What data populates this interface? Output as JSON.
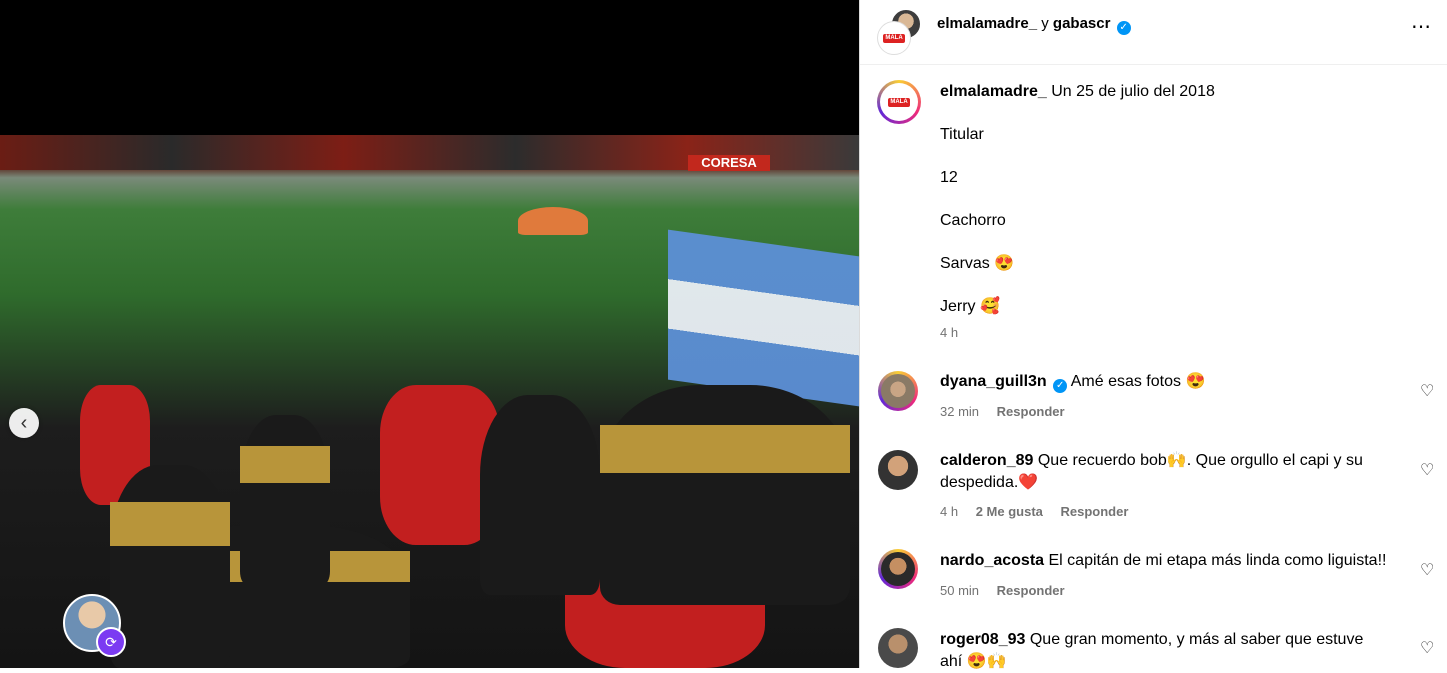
{
  "header": {
    "user1": "elmalamadre_",
    "joiner": "y",
    "user2": "gabascr",
    "more_icon": "more-horizontal-icon"
  },
  "media": {
    "sign_text": "CORESA",
    "prev_icon": "‹",
    "tag_badge_icon": "⟳"
  },
  "caption": {
    "username": "elmalamadre_",
    "first_line": "Un 25 de julio del 2018",
    "lines": [
      "Titular",
      "12",
      "Cachorro",
      "Sarvas 😍",
      "Jerry 🥰"
    ],
    "time": "4 h"
  },
  "comments": [
    {
      "username": "dyana_guill3n",
      "verified": true,
      "text": "Amé esas fotos 😍",
      "time": "32 min",
      "likes": "",
      "reply": "Responder"
    },
    {
      "username": "calderon_89",
      "verified": false,
      "text": "Que recuerdo bob🙌. Que orgullo el capi y su despedida.❤️",
      "time": "4 h",
      "likes": "2 Me gusta",
      "reply": "Responder"
    },
    {
      "username": "nardo_acosta",
      "verified": false,
      "text": "El capitán de mi etapa más linda como liguista!!",
      "time": "50 min",
      "likes": "",
      "reply": "Responder"
    },
    {
      "username": "roger08_93",
      "verified": false,
      "text": "Que gran momento, y más al saber que estuve ahí 😍🙌",
      "time": "",
      "likes": "",
      "reply": ""
    }
  ],
  "logo_text": "MALA MADRE",
  "colors": {
    "verified": "#0095f6",
    "meta": "#737373",
    "accent_red": "#c2281d"
  }
}
